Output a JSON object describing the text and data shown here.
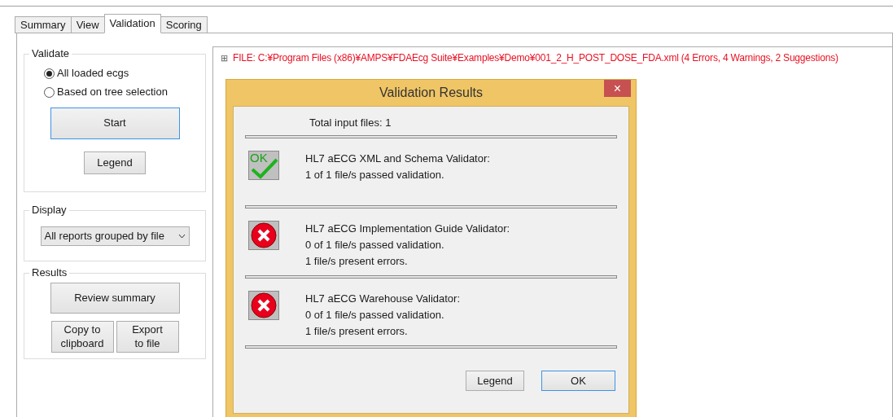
{
  "tabs": [
    {
      "label": "Summary",
      "selected": false
    },
    {
      "label": "View",
      "selected": false
    },
    {
      "label": "Validation",
      "selected": true
    },
    {
      "label": "Scoring",
      "selected": false
    }
  ],
  "validate": {
    "title": "Validate",
    "options": [
      {
        "label": "All loaded ecgs",
        "selected": true
      },
      {
        "label": "Based on tree selection",
        "selected": false
      }
    ],
    "start": "Start",
    "legend": "Legend"
  },
  "display": {
    "title": "Display",
    "value": "All reports grouped by file"
  },
  "results": {
    "title": "Results",
    "review": "Review summary",
    "copy": "Copy to clipboard",
    "export": "Export to file"
  },
  "tree": {
    "expander": "⊞",
    "item": "FILE: C:¥Program Files (x86)¥AMPS¥FDAEcg Suite¥Examples¥Demo¥001_2_H_POST_DOSE_FDA.xml (4 Errors, 4 Warnings, 2 Suggestions)"
  },
  "dialog": {
    "title": "Validation Results",
    "close": "×",
    "total": "Total input files: 1",
    "validators": [
      {
        "kind": "pass",
        "ok_label": "OK",
        "lines": [
          "HL7 aECG XML and Schema Validator:",
          "1 of 1 file/s passed validation."
        ]
      },
      {
        "kind": "fail",
        "lines": [
          "HL7 aECG Implementation Guide Validator:",
          "0 of 1 file/s passed validation.",
          "1 file/s present errors."
        ]
      },
      {
        "kind": "fail",
        "lines": [
          "HL7 aECG Warehouse Validator:",
          "0 of 1 file/s passed validation.",
          "1 file/s present errors."
        ]
      }
    ],
    "buttons": [
      {
        "label": "Legend",
        "selected": false
      },
      {
        "label": "OK",
        "selected": true
      }
    ]
  }
}
